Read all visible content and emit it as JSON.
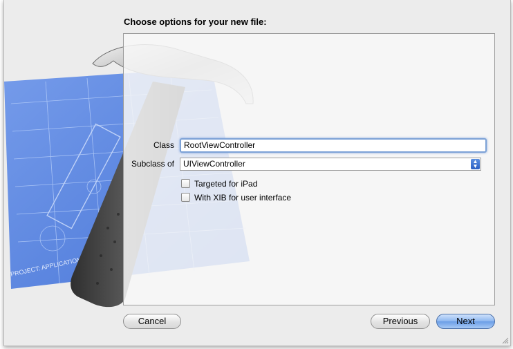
{
  "dialog": {
    "title": "Choose options for your new file:"
  },
  "form": {
    "class_label": "Class",
    "class_value": "RootViewController",
    "subclass_label": "Subclass of",
    "subclass_value": "UIViewController",
    "ipad_label": "Targeted for iPad",
    "ipad_checked": false,
    "xib_label": "With XIB for user interface",
    "xib_checked": false
  },
  "buttons": {
    "cancel": "Cancel",
    "previous": "Previous",
    "next": "Next"
  },
  "artwork": {
    "blueprint_text": "PROJECT: APPLICATION.APP",
    "blueprint_color": "#5b86e0",
    "icon_name": "xcode-hammer-blueprint-icon"
  },
  "colors": {
    "accent": "#4f8ae6",
    "sheet_bg": "#ececec"
  }
}
